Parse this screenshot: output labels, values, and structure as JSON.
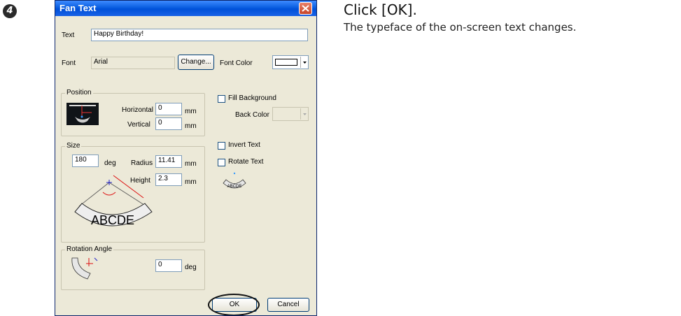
{
  "step": {
    "number": "4"
  },
  "instruction": {
    "title": "Click [OK].",
    "body": "The typeface of the on-screen text changes."
  },
  "dialog": {
    "title": "Fan Text",
    "text_label": "Text",
    "text_value": "Happy Birthday!",
    "font_label": "Font",
    "font_value": "Arial",
    "change_button": "Change...",
    "font_color_label": "Font Color",
    "position": {
      "label": "Position",
      "horizontal_label": "Horizontal",
      "horizontal_value": "0",
      "vertical_label": "Vertical",
      "vertical_value": "0",
      "unit": "mm"
    },
    "fill_background_label": "Fill Background",
    "back_color_label": "Back Color",
    "invert_text_label": "Invert Text",
    "rotate_text_label": "Rotate Text",
    "size": {
      "label": "Size",
      "deg_value": "180",
      "deg_unit": "deg",
      "radius_label": "Radius",
      "radius_value": "11.41",
      "height_label": "Height",
      "height_value": "2.3",
      "unit": "mm",
      "preview_text": "ABCDE"
    },
    "rotation": {
      "label": "Rotation Angle",
      "value": "0",
      "unit": "deg"
    },
    "ok_button": "OK",
    "cancel_button": "Cancel",
    "colors": {
      "titlebar": "#0a5ee0",
      "dialog_bg": "#ece9d8",
      "highlight": "#d11"
    }
  }
}
